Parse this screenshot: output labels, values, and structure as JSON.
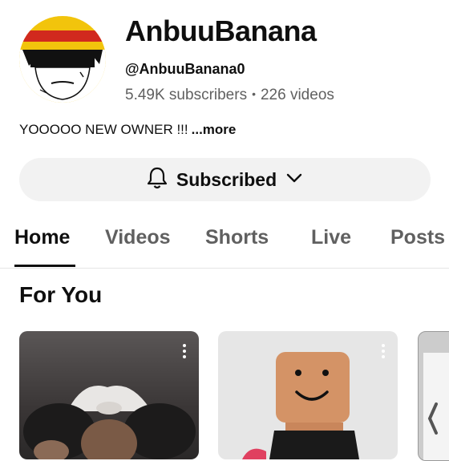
{
  "channel": {
    "name": "AnbuuBanana",
    "handle": "@AnbuuBanana0",
    "subscribers": "5.49K subscribers",
    "separator": "•",
    "videos": "226 videos",
    "description": "YOOOOO NEW OWNER !!!",
    "more": "...more"
  },
  "subscribe": {
    "label": "Subscribed",
    "bell_icon": "bell-icon",
    "chevron_icon": "chevron-down-icon"
  },
  "tabs": [
    {
      "label": "Home",
      "active": true
    },
    {
      "label": "Videos",
      "active": false
    },
    {
      "label": "Shorts",
      "active": false
    },
    {
      "label": "Live",
      "active": false
    },
    {
      "label": "Posts",
      "active": false
    }
  ],
  "section": {
    "title": "For You"
  },
  "colors": {
    "button_bg": "#f2f2f2",
    "text_primary": "#0f0f0f",
    "text_secondary": "#606060"
  }
}
